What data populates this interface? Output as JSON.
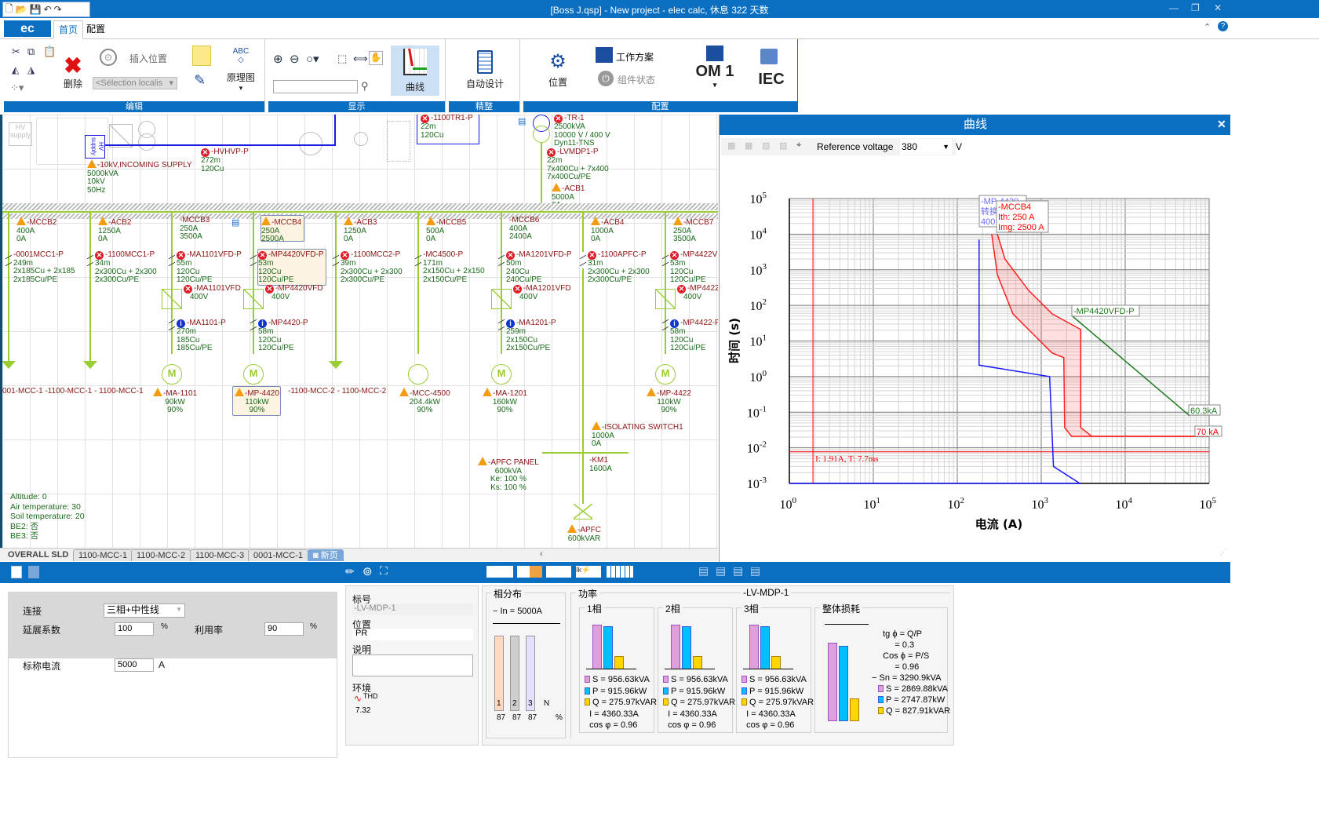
{
  "titlebar": {
    "title": "[Boss J.qsp] - New project - elec calc, 休息 322 天数"
  },
  "ribbon_tabs": {
    "app": "ec",
    "home": "首页",
    "config": "配置"
  },
  "ribbon": {
    "edit": {
      "label": "编辑",
      "insert_location": "插入位置",
      "delete": "删除",
      "selection_placeholder": "<Sélection localis",
      "schematic": "原理图"
    },
    "display": {
      "label": "显示",
      "curves": "曲线",
      "search_value": ""
    },
    "refine": {
      "label": "精整",
      "auto_design": "自动设计"
    },
    "config": {
      "label": "配置",
      "location": "位置",
      "work_plan": "工作方案",
      "component_state": "组件状态",
      "om": "OM 1",
      "iec": "IEC"
    }
  },
  "sld": {
    "top": {
      "palette_hv": "HV supply",
      "hv_block": "HV supply",
      "incoming": {
        "name": "-10kV,INCOMING SUPPLY",
        "lines": [
          "5000kVA",
          "10kV",
          "50Hz"
        ]
      },
      "hvhvp": {
        "name": "-HVHVP-P",
        "lines": [
          "272m",
          "120Cu"
        ]
      },
      "tr1p": {
        "name": "-1100TR1-P",
        "lines": [
          "22m",
          "120Cu"
        ]
      },
      "tr1": {
        "name": "-TR-1",
        "lines": [
          "2500kVA",
          "10000 V / 400 V",
          "Dyn11-TNS"
        ]
      },
      "lvmdp": {
        "name": "-LVMDP1-P",
        "lines": [
          "22m",
          "7x400Cu + 7x400",
          "7x400Cu/PE"
        ]
      },
      "acb1": {
        "name": "-ACB1",
        "lines": [
          "5000A",
          "0A"
        ]
      }
    },
    "feeders": [
      {
        "breaker": {
          "status": "warn",
          "name": "-MCCB2",
          "l1": "400A",
          "l2": "0A"
        },
        "cable": {
          "status": "none",
          "name": "-0001MCC1-P",
          "l0": "249m",
          "l1": "2x185Cu + 2x185",
          "l2": "2x185Cu/PE"
        },
        "load": {
          "type": "arrow"
        }
      },
      {
        "breaker": {
          "status": "warn",
          "name": "-ACB2",
          "l1": "1250A",
          "l2": "0A"
        },
        "cable": {
          "status": "err",
          "name": "-1100MCC1-P",
          "l0": "34m",
          "l1": "2x300Cu + 2x300",
          "l2": "2x300Cu/PE"
        },
        "load": {
          "type": "arrow"
        }
      },
      {
        "breaker": {
          "status": "none",
          "name": "-MCCB3",
          "l1": "250A",
          "l2": "3500A"
        },
        "cable": {
          "status": "err",
          "name": "-MA1101VFD-P",
          "l0": "55m",
          "l1": "120Cu",
          "l2": "120Cu/PE"
        },
        "vfd": {
          "status": "err",
          "name": "-MA1101VFD",
          "l1": "400V"
        },
        "cable2": {
          "status": "info",
          "name": "-MA1101-P",
          "l0": "270m",
          "l1": "185Cu",
          "l2": "185Cu/PE"
        },
        "load": {
          "type": "motor",
          "status": "warn",
          "name": "-MA-1101",
          "l1": "90kW",
          "l2": "90%"
        }
      },
      {
        "selected": true,
        "breaker": {
          "status": "warn",
          "name": "-MCCB4",
          "l1": "250A",
          "l2": "2500A"
        },
        "cable": {
          "status": "err",
          "name": "-MP4420VFD-P",
          "l0": "53m",
          "l1": "120Cu",
          "l2": "120Cu/PE"
        },
        "vfd": {
          "status": "err",
          "name": "-MP4420VFD",
          "l1": "400V"
        },
        "cable2": {
          "status": "info",
          "name": "-MP4420-P",
          "l0": "58m",
          "l1": "120Cu",
          "l2": "120Cu/PE"
        },
        "load": {
          "type": "motor",
          "status": "warn",
          "name": "-MP-4420",
          "l1": "110kW",
          "l2": "90%"
        }
      },
      {
        "breaker": {
          "status": "warn",
          "name": "-ACB3",
          "l1": "1250A",
          "l2": "0A"
        },
        "cable": {
          "status": "err",
          "name": "-1100MCC2-P",
          "l0": "39m",
          "l1": "2x300Cu + 2x300",
          "l2": "2x300Cu/PE"
        },
        "load": {
          "type": "arrow"
        }
      },
      {
        "breaker": {
          "status": "warn",
          "name": "-MCCB5",
          "l1": "500A",
          "l2": "0A"
        },
        "cable": {
          "status": "none",
          "name": "-MC4500-P",
          "l0": "171m",
          "l1": "2x150Cu + 2x150",
          "l2": "2x150Cu/PE"
        },
        "load": {
          "type": "circle",
          "status": "warn",
          "name": "-MCC-4500",
          "l1": "204.4kW",
          "l2": "90%"
        }
      },
      {
        "breaker": {
          "status": "none",
          "name": "-MCCB6",
          "l1": "400A",
          "l2": "2400A"
        },
        "cable": {
          "status": "err",
          "name": "-MA1201VFD-P",
          "l0": "50m",
          "l1": "240Cu",
          "l2": "240Cu/PE"
        },
        "vfd": {
          "status": "err",
          "name": "-MA1201VFD",
          "l1": "400V"
        },
        "cable2": {
          "status": "info",
          "name": "-MA1201-P",
          "l0": "259m",
          "l1": "2x150Cu",
          "l2": "2x150Cu/PE"
        },
        "load": {
          "type": "motor",
          "status": "warn",
          "name": "-MA-1201",
          "l1": "160kW",
          "l2": "90%"
        }
      },
      {
        "breaker": {
          "status": "warn",
          "name": "-ACB4",
          "l1": "1000A",
          "l2": "0A"
        },
        "cable": {
          "status": "err",
          "name": "-1100APFC-P",
          "l0": "31m",
          "l1": "2x300Cu + 2x300",
          "l2": "2x300Cu/PE"
        },
        "load": {
          "type": "none"
        }
      },
      {
        "breaker": {
          "status": "warn",
          "name": "-MCCB7",
          "l1": "250A",
          "l2": "3500A"
        },
        "cable": {
          "status": "err",
          "name": "-MP4422VFD-P",
          "l0": "53m",
          "l1": "120Cu",
          "l2": "120Cu/PE"
        },
        "vfd": {
          "status": "err",
          "name": "-MP4422VFD",
          "l1": "400V"
        },
        "cable2": {
          "status": "info",
          "name": "-MP4422-P",
          "l0": "58m",
          "l1": "120Cu",
          "l2": "120Cu/PE"
        },
        "load": {
          "type": "motor",
          "status": "warn",
          "name": "-MP-4422",
          "l1": "110kW",
          "l2": "90%"
        }
      }
    ],
    "mcc1_label": "001-MCC-1 -1100-MCC-1 - 1100-MCC-1",
    "mcc2_label": "-1100-MCC-2 - 1100-MCC-2",
    "isolating": {
      "name": "-ISOLATING SWITCH1",
      "lines": [
        "1000A",
        "0A"
      ]
    },
    "km1": {
      "name": "-KM1",
      "lines": [
        "1600A"
      ]
    },
    "apfc_panel": {
      "name": "-APFC PANEL",
      "lines": [
        "600kVA",
        "Ke: 100 %",
        "Ks: 100 %"
      ]
    },
    "apfc": {
      "name": "-APFC",
      "lines": [
        "600kVAR"
      ]
    },
    "env": [
      "Altitude: 0",
      "Air temperature: 30",
      "Soil temperature: 20",
      "BE2: 否",
      "BE3: 否"
    ]
  },
  "sheet_tabs": [
    "OVERALL SLD",
    "1100-MCC-1",
    "1100-MCC-2",
    "1100-MCC-3",
    "0001-MCC-1",
    "新页"
  ],
  "curve_panel": {
    "title": "曲线",
    "ref_voltage_label": "Reference voltage",
    "ref_voltage": "380",
    "unit": "V"
  },
  "chart_data": {
    "type": "line",
    "xscale": "log",
    "yscale": "log",
    "xlim": [
      1,
      100000
    ],
    "ylim": [
      0.001,
      100000
    ],
    "xlabel": "电流 (A)",
    "ylabel": "时间 (s)",
    "grid": true,
    "xticks": [
      "0",
      "1",
      "2",
      "3",
      "4",
      "5"
    ],
    "yticks": [
      "5",
      "4",
      "3",
      "2",
      "1",
      "0",
      "-1",
      "-2",
      "-3"
    ],
    "series": [
      {
        "name": "-MP-4420",
        "color": "#1a1aff",
        "label_lines": [
          "-MP-4420",
          "转换",
          "400"
        ],
        "points": [
          [
            1,
            0.001
          ],
          [
            2880,
            0.001
          ],
          [
            1400,
            0.003
          ],
          [
            1260,
            1
          ],
          [
            182,
            2.1
          ],
          [
            182,
            7000
          ]
        ]
      },
      {
        "name": "-MCCB4",
        "color": "#ff2020",
        "band": true,
        "label_lines": [
          "-MCCB4",
          "Ith: 250 A",
          "Img: 2500 A"
        ],
        "lower": [
          [
            257,
            10000
          ],
          [
            300,
            720
          ],
          [
            460,
            58
          ],
          [
            875,
            12.6
          ],
          [
            1350,
            4.6
          ],
          [
            1860,
            3.4
          ],
          [
            1900,
            0.037
          ],
          [
            2300,
            0.021
          ],
          [
            100000,
            0.021
          ]
        ],
        "upper": [
          [
            300,
            10000
          ],
          [
            370,
            2000
          ],
          [
            710,
            260
          ],
          [
            1350,
            58
          ],
          [
            2950,
            21
          ],
          [
            2950,
            0.037
          ],
          [
            4000,
            0.021
          ],
          [
            100000,
            0.021
          ]
        ],
        "end_label": "70 kA"
      },
      {
        "name": "-MP4420VFD-P",
        "color": "#1e7a1e",
        "label_lines": [
          "-MP4420VFD-P"
        ],
        "points": [
          [
            2350,
            50
          ],
          [
            58800,
            0.079
          ]
        ],
        "end_label": "60.3kA"
      }
    ],
    "cursor": {
      "current_A": 1.91,
      "time_s": 0.0077,
      "label": "I: 1.91A, T: 7.7ms"
    }
  },
  "bottom": {
    "left": {
      "connection_label": "连接",
      "connection": "三相+中性线",
      "ext_label": "延展系数",
      "ext": "100",
      "ext_unit": "%",
      "util_label": "利用率",
      "util": "90",
      "util_unit": "%",
      "rated_label": "标称电流",
      "rated": "5000",
      "rated_unit": "A"
    },
    "props": {
      "tag_label": "标号",
      "tag": "-LV-MDP-1",
      "loc_label": "位置",
      "loc": "PR",
      "desc_label": "说明",
      "desc": "",
      "env_label": "环境",
      "thd_label": "THD",
      "thd": "7.32"
    },
    "phase": {
      "title": "相分布",
      "in": "In = 5000A",
      "bars": [
        "1",
        "2",
        "3",
        "N"
      ],
      "values": [
        "87",
        "87",
        "87"
      ],
      "pct": "%",
      "fill": [
        87,
        87,
        87
      ],
      "colors": [
        "#ffd9bf",
        "#cfcfcf",
        "#e4e0ff"
      ]
    },
    "power": {
      "title": "功率",
      "board": "-LV-MDP-1",
      "phases": [
        {
          "title": "1相",
          "S": "S = 956.63kVA",
          "P": "P = 915.96kW",
          "Q": "Q = 275.97kVAR",
          "I": "I = 4360.33A",
          "cos": "cos φ = 0.96",
          "vals": [
            956.63,
            915.96,
            275.97
          ]
        },
        {
          "title": "2相",
          "S": "S = 956.63kVA",
          "P": "P = 915.96kW",
          "Q": "Q = 275.97kVAR",
          "I": "I = 4360.33A",
          "cos": "cos φ = 0.96",
          "vals": [
            956.63,
            915.96,
            275.97
          ]
        },
        {
          "title": "3相",
          "S": "S = 956.63kVA",
          "P": "P = 915.96kW",
          "Q": "Q = 275.97kVAR",
          "I": "I = 4360.33A",
          "cos": "cos φ = 0.96",
          "vals": [
            956.63,
            915.96,
            275.97
          ]
        }
      ],
      "total": {
        "title": "整体损耗",
        "tg": "tg ϕ = Q/P",
        "tg_v": "= 0.3",
        "cos": "Cos ϕ = P/S",
        "cos_v": "= 0.96",
        "sn": "Sn = 3290.9kVA",
        "S": "S = 2869.88kVA",
        "P": "P = 2747.87kW",
        "Q": "Q = 827.91kVAR",
        "vals": [
          2869.88,
          2747.87,
          827.91
        ],
        "sn_val": 3290.9
      }
    },
    "colors": {
      "S": "#dda0dd",
      "P": "#00bfff",
      "Q": "#ffd700"
    }
  }
}
